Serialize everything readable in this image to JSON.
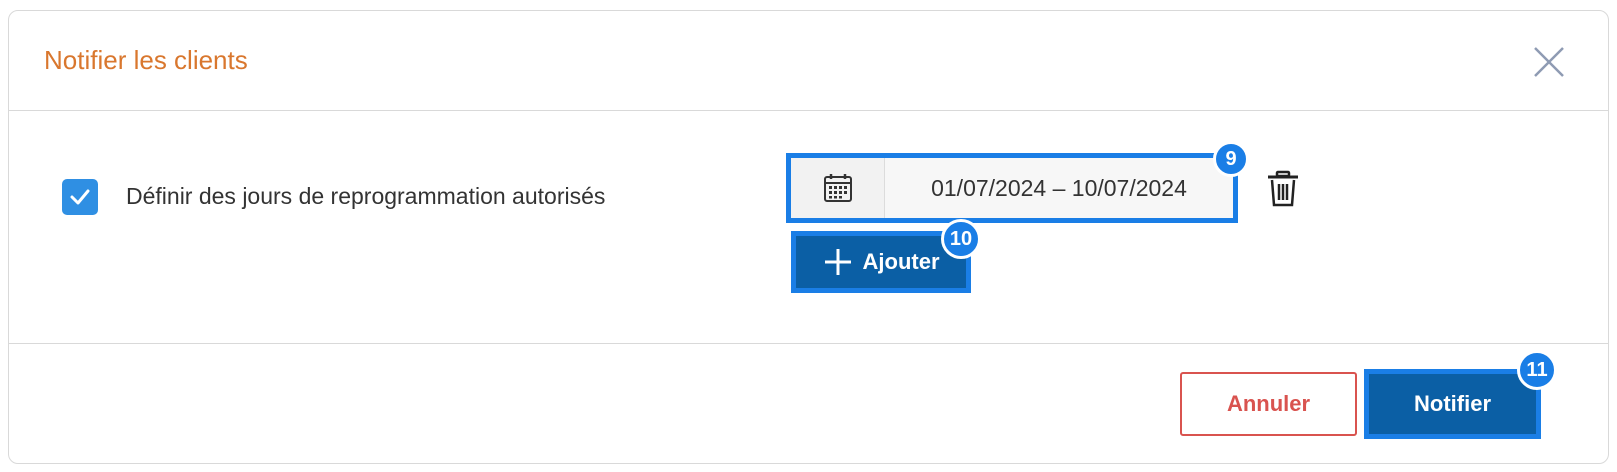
{
  "dialog": {
    "title": "Notifier les clients"
  },
  "reschedule": {
    "checked": true,
    "label": "Définir des jours de reprogrammation autorisés",
    "date_range": "01/07/2024 – 10/07/2024",
    "add_label": "Ajouter"
  },
  "footer": {
    "cancel_label": "Annuler",
    "notify_label": "Notifier"
  },
  "badges": {
    "date_range": "9",
    "add": "10",
    "notify": "11"
  },
  "colors": {
    "title": "#d9772e",
    "primary": "#0b5fa5",
    "highlight": "#1a7ee6",
    "cancel": "#d9534f",
    "checkbox": "#2f8fe3"
  },
  "icons": {
    "close": "close-icon",
    "check": "check-icon",
    "calendar": "calendar-icon",
    "trash": "trash-icon",
    "plus": "plus-icon"
  }
}
